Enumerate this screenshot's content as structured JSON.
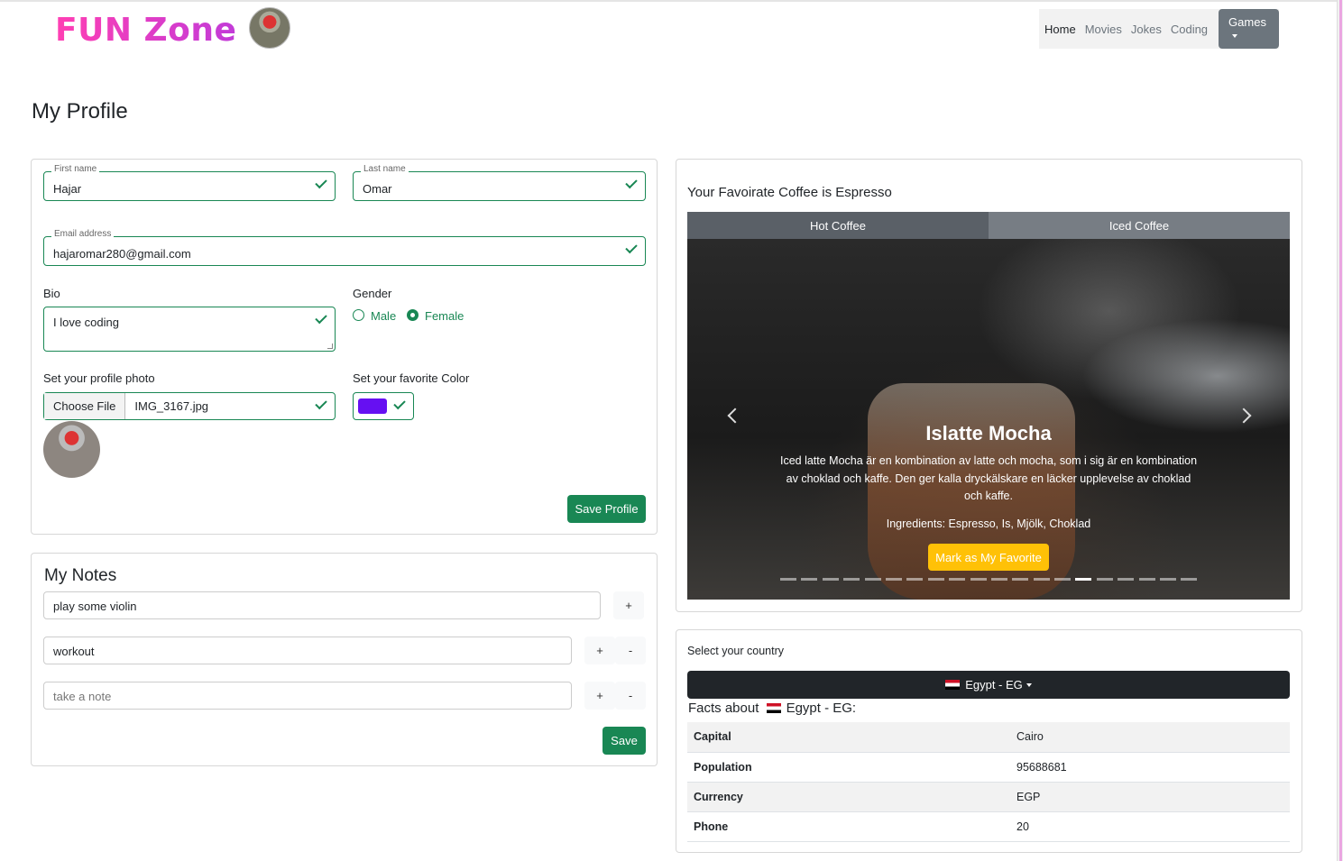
{
  "brand": {
    "name": "FUN Zone"
  },
  "nav": {
    "items": [
      "Home",
      "Movies",
      "Jokes",
      "Coding"
    ],
    "games_label": "Games"
  },
  "page_title": "My Profile",
  "profile": {
    "first_name_label": "First name",
    "first_name": "Hajar",
    "last_name_label": "Last name",
    "last_name": "Omar",
    "email_label": "Email address",
    "email": "hajaromar280@gmail.com",
    "bio_label": "Bio",
    "bio": "I love coding",
    "gender_label": "Gender",
    "gender_options": [
      "Male",
      "Female"
    ],
    "gender_selected": "Female",
    "photo_label": "Set your profile photo",
    "choose_file_label": "Choose File",
    "file_name": "IMG_3167.jpg",
    "color_label": "Set your favorite Color",
    "favorite_color": "#6610f2",
    "save_label": "Save Profile"
  },
  "notes": {
    "title": "My Notes",
    "items": [
      "play some violin",
      "workout"
    ],
    "placeholder": "take a note",
    "add_label": "+",
    "remove_label": "-",
    "save_label": "Save"
  },
  "coffee": {
    "title": "Your Favoirate Coffee is Espresso",
    "tabs": [
      "Hot Coffee",
      "Iced Coffee"
    ],
    "slide_title": "Islatte Mocha",
    "slide_description": "Iced latte Mocha är en kombination av latte och mocha, som i sig är en kombination av choklad och kaffe. Den ger kalla dryckälskare en läcker upplevelse av choklad och kaffe.",
    "slide_ingredients": "Ingredients: Espresso, Is, Mjölk, Choklad",
    "favorite_button": "Mark as My Favorite",
    "indicator_count": 20,
    "active_indicator": 14
  },
  "country": {
    "select_label": "Select your country",
    "selected": "Egypt - EG",
    "facts_prefix": "Facts about",
    "facts_country": "Egypt - EG:",
    "facts": [
      {
        "key": "Capital",
        "value": "Cairo"
      },
      {
        "key": "Population",
        "value": "95688681"
      },
      {
        "key": "Currency",
        "value": "EGP"
      },
      {
        "key": "Phone",
        "value": "20"
      }
    ]
  },
  "colors": {
    "success": "#198754",
    "dark": "#212529",
    "warning": "#ffc107",
    "brand_pink": "#ff3fb3"
  }
}
